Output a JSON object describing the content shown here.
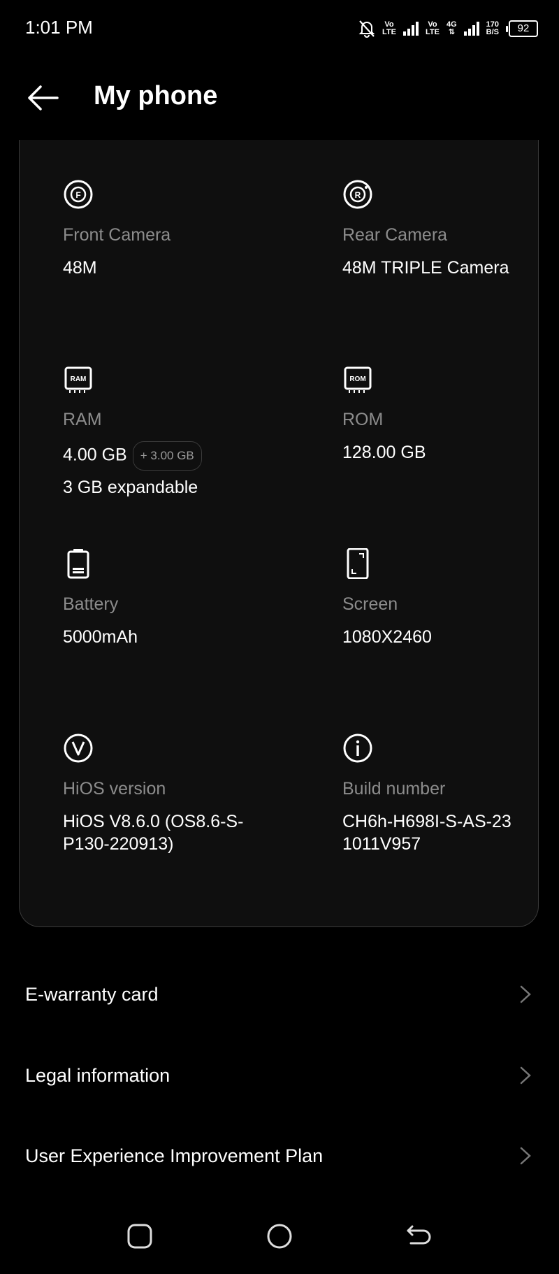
{
  "status_bar": {
    "time": "1:01 PM",
    "volte1_top": "Vo",
    "volte1_bottom": "LTE",
    "volte2_top": "Vo",
    "volte2_bottom": "LTE",
    "net_type": "4G",
    "speed_value": "170",
    "speed_unit": "B/S",
    "battery_level": "92"
  },
  "header": {
    "title": "My phone"
  },
  "specs": [
    {
      "icon": "front-camera-icon",
      "label": "Front Camera",
      "value": "48M"
    },
    {
      "icon": "rear-camera-icon",
      "label": "Rear Camera",
      "value": "48M TRIPLE Camera"
    },
    {
      "icon": "ram-chip-icon",
      "icon_text": "RAM",
      "label": "RAM",
      "value": "4.00 GB",
      "chip": "+ 3.00 GB",
      "extra": "3 GB expandable"
    },
    {
      "icon": "rom-chip-icon",
      "icon_text": "ROM",
      "label": "ROM",
      "value": "128.00 GB"
    },
    {
      "icon": "battery-icon",
      "label": "Battery",
      "value": "5000mAh"
    },
    {
      "icon": "screen-icon",
      "label": "Screen",
      "value": "1080X2460"
    },
    {
      "icon": "hios-version-icon",
      "label": "HiOS version",
      "value": "HiOS V8.6.0 (OS8.6-S-P130-220913)"
    },
    {
      "icon": "info-icon",
      "label": "Build number",
      "value": "CH6h-H698I-S-AS-231011V957"
    }
  ],
  "list": [
    {
      "label": "E-warranty card"
    },
    {
      "label": "Legal information"
    },
    {
      "label": "User Experience Improvement Plan"
    }
  ],
  "colors": {
    "background": "#000000",
    "card": "#0f0f0f",
    "label": "#8c8c8c",
    "text": "#ffffff"
  }
}
